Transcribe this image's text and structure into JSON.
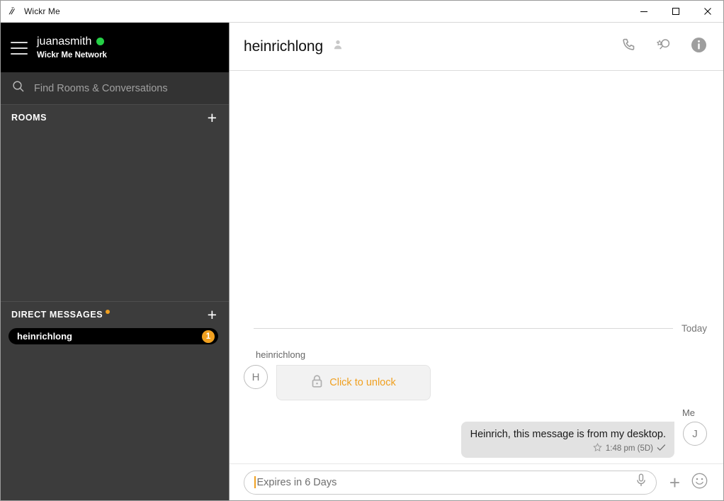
{
  "window": {
    "title": "Wickr Me",
    "app_icon": "wickr-logo-icon",
    "minimize_label": "Minimize",
    "maximize_label": "Maximize",
    "close_label": "Close"
  },
  "sidebar": {
    "profile": {
      "username": "juanasmith",
      "network": "Wickr Me Network",
      "status": "online",
      "status_color": "#25d046",
      "menu_icon": "hamburger-menu-icon"
    },
    "search": {
      "placeholder": "Find Rooms & Conversations",
      "value": "",
      "icon": "search-icon"
    },
    "rooms": {
      "title": "ROOMS",
      "add_label": "+",
      "items": []
    },
    "direct_messages": {
      "title": "DIRECT MESSAGES",
      "has_unread_indicator": true,
      "unread_dot_color": "#f0a020",
      "add_label": "+",
      "items": [
        {
          "name": "heinrichlong",
          "badge": "1",
          "selected": true
        }
      ]
    }
  },
  "chat": {
    "header": {
      "title": "heinrichlong",
      "member_icon": "person-icon",
      "actions": [
        {
          "name": "call-button",
          "icon": "phone-icon"
        },
        {
          "name": "search-messages-button",
          "icon": "search-star-icon"
        },
        {
          "name": "info-button",
          "icon": "info-circle-icon"
        }
      ]
    },
    "day_divider": "Today",
    "messages": [
      {
        "direction": "incoming",
        "sender": "heinrichlong",
        "avatar_initial": "H",
        "locked": true,
        "unlock_label": "Click to unlock",
        "unlock_icon": "lock-icon",
        "unlock_color": "#f0a020"
      },
      {
        "direction": "outgoing",
        "sender": "Me",
        "avatar_initial": "J",
        "text": "Heinrich, this message is from my desktop.",
        "star_icon": "star-outline-icon",
        "timestamp": "1:48 pm (5D)",
        "status_icon": "checkmark-icon"
      }
    ]
  },
  "composer": {
    "placeholder": "Expires in 6 Days",
    "value": "",
    "caret_color": "#f0a020",
    "mic_icon": "microphone-icon",
    "attach_label": "+",
    "emoji_icon": "smiley-icon"
  }
}
